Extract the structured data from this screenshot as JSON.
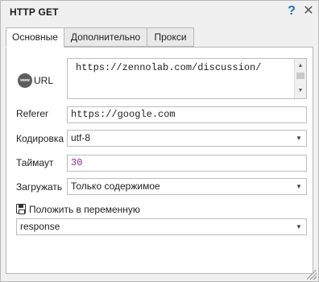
{
  "window": {
    "title": "HTTP GET",
    "help_glyph": "?",
    "close_glyph": "✕"
  },
  "tabs": [
    {
      "label": "Основные",
      "active": true
    },
    {
      "label": "Дополнительно",
      "active": false
    },
    {
      "label": "Прокси",
      "active": false
    }
  ],
  "url": {
    "icon_text": "www",
    "label": "URL",
    "value": "https://zennolab.com/discussion/"
  },
  "referer": {
    "label": "Referer",
    "value": "https://google.com"
  },
  "encoding": {
    "label": "Кодировка",
    "value": "utf-8"
  },
  "timeout": {
    "label": "Таймаут",
    "value": "30",
    "value_color": "#8b2a8b"
  },
  "load": {
    "label": "Загружать",
    "value": "Только содержимое"
  },
  "save_to_var": {
    "label": "Положить в переменную",
    "value": "response"
  },
  "icons": {
    "help": "help-icon",
    "close": "close-icon",
    "www": "www-globe-icon",
    "save": "save-disk-icon",
    "dropdown": "chevron-down-icon",
    "grip": "resize-grip-icon"
  }
}
